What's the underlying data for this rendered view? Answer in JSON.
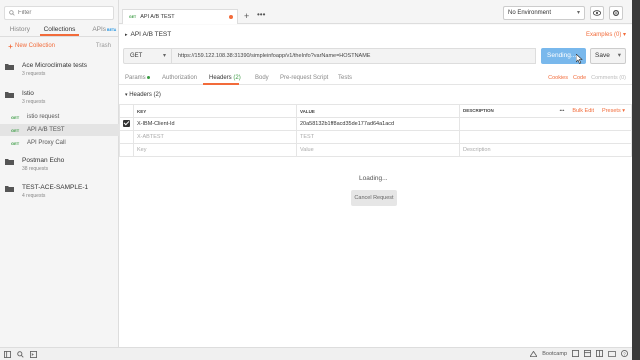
{
  "sidebar": {
    "search_placeholder": "Filter",
    "tabs": [
      {
        "label": "History"
      },
      {
        "label": "Collections"
      },
      {
        "label": "APIs",
        "badge": "BETA"
      }
    ],
    "new_collection": "New Collection",
    "trash": "Trash",
    "collections": [
      {
        "name": "Ace Microclimate tests",
        "requests": "3 requests"
      },
      {
        "name": "Istio",
        "requests": "3 requests"
      },
      {
        "name": "Postman Echo",
        "requests": "38 requests"
      },
      {
        "name": "TEST-ACE-SAMPLE-1",
        "requests": "4 requests"
      }
    ],
    "istio_requests": [
      {
        "method": "GET",
        "name": "istio request"
      },
      {
        "method": "GET",
        "name": "API A/B TEST"
      },
      {
        "method": "GET",
        "name": "API Proxy Call"
      }
    ]
  },
  "topbar": {
    "tab_method": "GET",
    "tab_title": "API A/B TEST",
    "environment": "No Environment"
  },
  "request": {
    "title": "API A/B TEST",
    "examples": "Examples (0)",
    "method": "GET",
    "url": "https://159.122.108.38:31390/simpleinfoapp/v1/theInfo?varName=HOSTNAME",
    "send_label": "Sending...",
    "save_label": "Save",
    "subtabs": [
      {
        "label": "Params"
      },
      {
        "label": "Authorization"
      },
      {
        "label": "Headers",
        "count": "(2)"
      },
      {
        "label": "Body"
      },
      {
        "label": "Pre-request Script"
      },
      {
        "label": "Tests"
      }
    ],
    "links": [
      "Cookies",
      "Code",
      "Comments (0)"
    ],
    "headers_section": "Headers (2)",
    "table": {
      "columns": [
        "KEY",
        "VALUE",
        "DESCRIPTION"
      ],
      "bulk_edit": "Bulk Edit",
      "presets": "Presets",
      "rows": [
        {
          "key": "X-IBM-Client-Id",
          "value": "20a58132b1ff8acd35de177ad64a1acd",
          "description": ""
        },
        {
          "key": "X-ABTEST",
          "value": "TEST",
          "description": ""
        }
      ],
      "placeholder": {
        "key": "Key",
        "value": "Value",
        "description": "Description"
      }
    },
    "loading": "Loading...",
    "cancel": "Cancel Request"
  },
  "footer": {
    "bootcamp": "Bootcamp"
  },
  "colors": {
    "accent": "#f26b3a",
    "send": "#79b8ec",
    "get_method": "#3a9b43"
  }
}
